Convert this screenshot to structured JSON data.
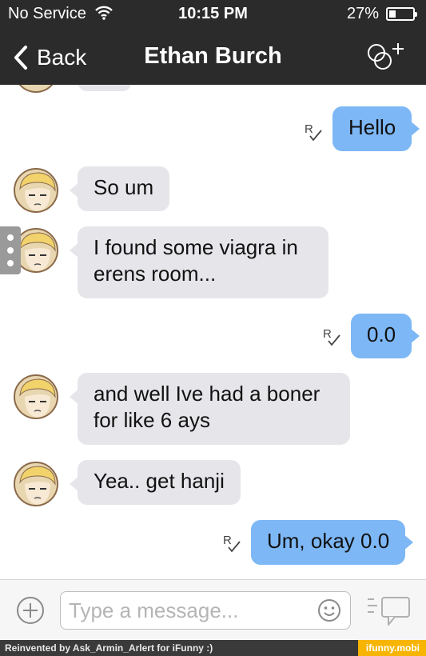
{
  "status_bar": {
    "carrier": "No Service",
    "time": "10:15 PM",
    "battery_pct": "27%",
    "battery_level": 0.27
  },
  "nav": {
    "back_label": "Back",
    "title": "Ethan Burch",
    "group_add_icon": "group-add-icon"
  },
  "messages": [
    {
      "from": "me",
      "text": "Hello"
    },
    {
      "from": "them",
      "text": "So um"
    },
    {
      "from": "them",
      "text_lines": [
        "I found some viagra in",
        "erens room..."
      ]
    },
    {
      "from": "me",
      "text": "0.0"
    },
    {
      "from": "them",
      "text_lines": [
        "and well Ive had a boner",
        "for like 6  ays"
      ]
    },
    {
      "from": "them",
      "text": "Yea.. get hanji"
    },
    {
      "from": "me",
      "text": "Um, okay 0.0"
    }
  ],
  "composer": {
    "placeholder": "Type a message..."
  },
  "watermark": {
    "credit": "Reinvented by Ask_Armin_Arlert for iFunny :)",
    "site": "ifunny.mobi"
  },
  "colors": {
    "header_bg": "#2b2b2b",
    "outgoing_bubble": "#7db7f6",
    "incoming_bubble": "#e6e6ea"
  }
}
